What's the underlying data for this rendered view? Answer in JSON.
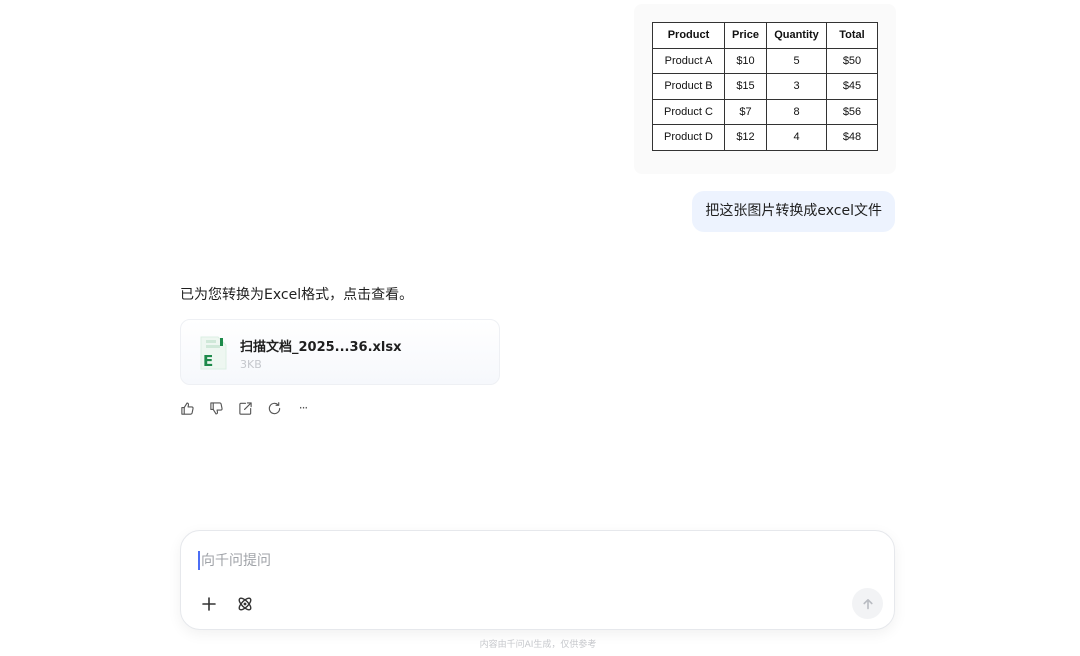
{
  "uploaded_image": {
    "table": {
      "headers": [
        "Product",
        "Price",
        "Quantity",
        "Total"
      ],
      "rows": [
        [
          "Product A",
          "$10",
          "5",
          "$50"
        ],
        [
          "Product B",
          "$15",
          "3",
          "$45"
        ],
        [
          "Product C",
          "$7",
          "8",
          "$56"
        ],
        [
          "Product D",
          "$12",
          "4",
          "$48"
        ]
      ]
    }
  },
  "user_message": "把这张图片转换成excel文件",
  "assistant": {
    "reply": "已为您转换为Excel格式，点击查看。",
    "file": {
      "name": "扫描文档_2025...36.xlsx",
      "size": "3KB",
      "icon_letter": "E",
      "icon": "excel-file-icon"
    },
    "actions": [
      "thumbs-up-icon",
      "thumbs-down-icon",
      "share-icon",
      "regenerate-icon",
      "more-icon"
    ],
    "more_label": "···"
  },
  "input": {
    "placeholder": "向千问提问",
    "value": ""
  },
  "disclaimer": "内容由千问AI生成，仅供参考",
  "colors": {
    "user_bubble": "#edf3fe",
    "accent": "#4c6ef5",
    "excel_green": "#1d8a4a"
  }
}
